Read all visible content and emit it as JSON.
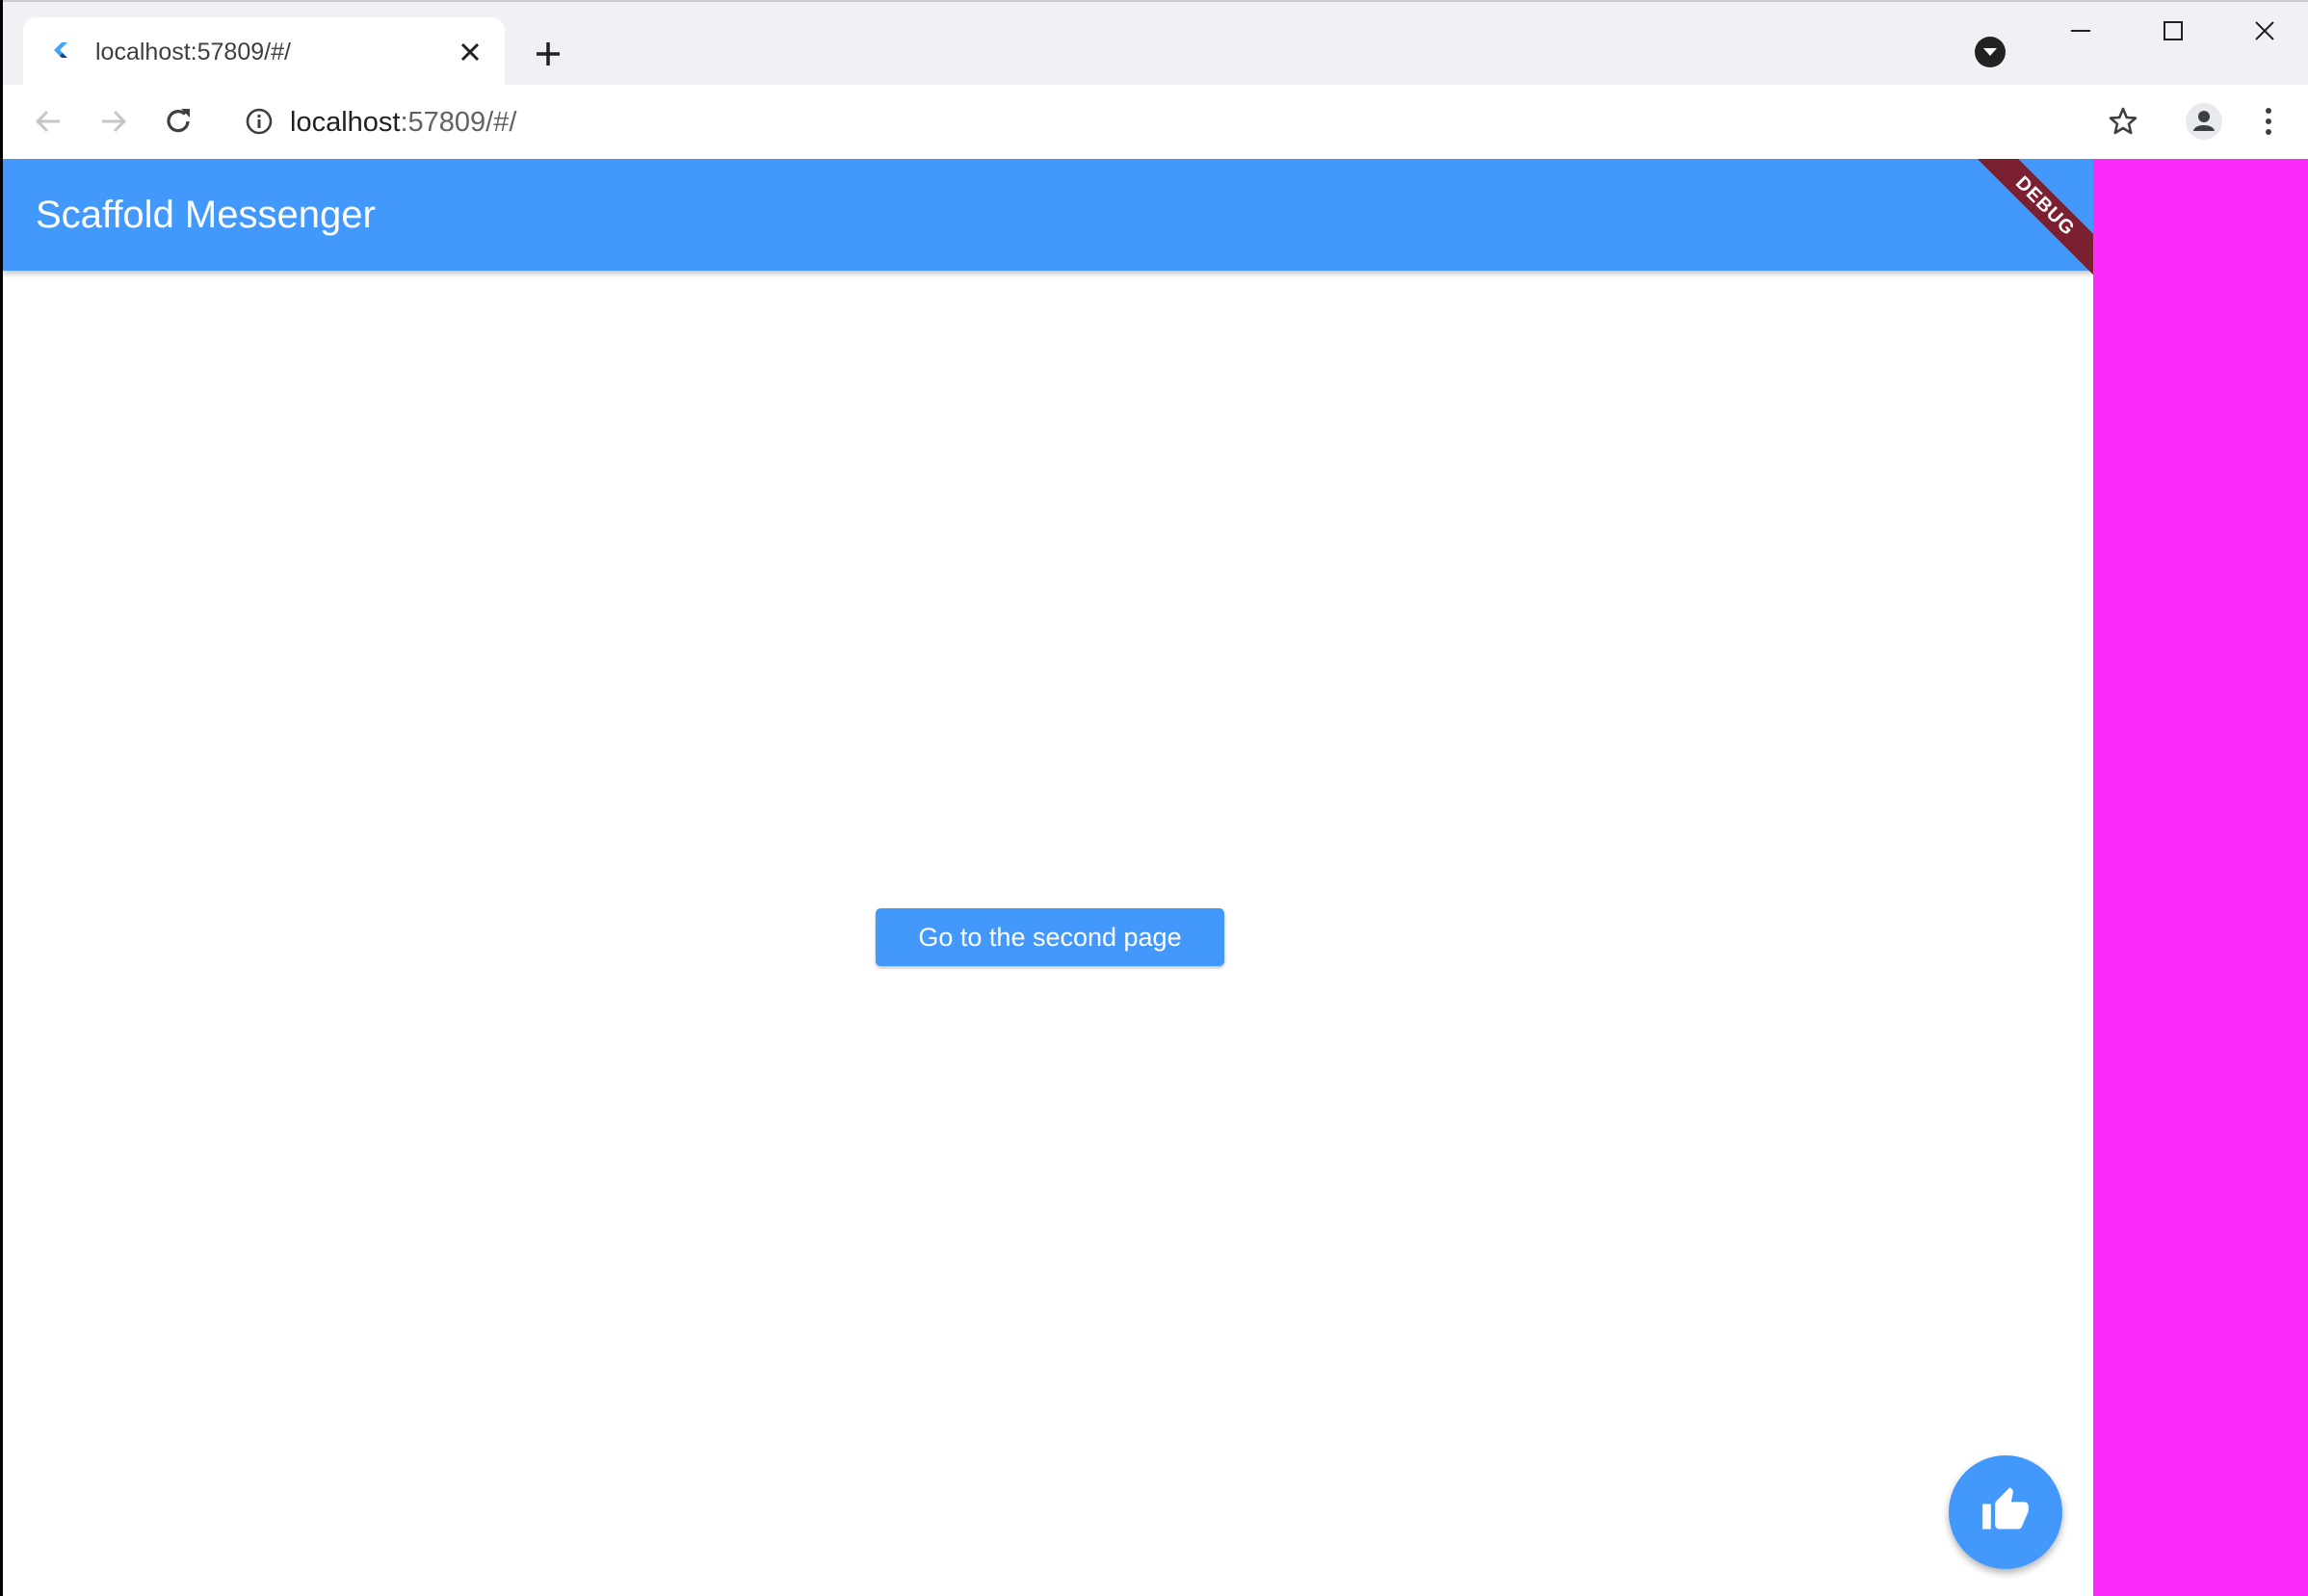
{
  "browser": {
    "tab": {
      "title": "localhost:57809/#/"
    },
    "address_bar": {
      "host": "localhost",
      "path": ":57809/#/"
    }
  },
  "app": {
    "appbar_title": "Scaffold Messenger",
    "debug_banner": "DEBUG",
    "primary_button_label": "Go to the second page",
    "fab_icon": "thumb-up-icon"
  },
  "colors": {
    "primary": "#4399fb",
    "debug_ribbon": "#7a2031",
    "side_panel": "#fb2cfb"
  }
}
